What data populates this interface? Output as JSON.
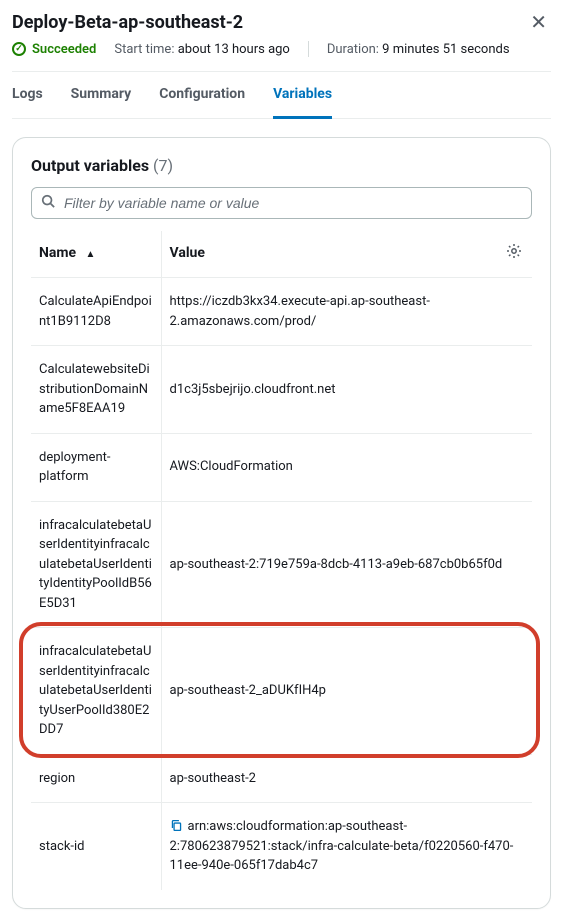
{
  "header": {
    "title": "Deploy-Beta-ap-southeast-2"
  },
  "status": {
    "text": "Succeeded",
    "start_label": "Start time:",
    "start_value": "about 13 hours ago",
    "duration_label": "Duration:",
    "duration_value": "9 minutes 51 seconds"
  },
  "tabs": {
    "logs": "Logs",
    "summary": "Summary",
    "configuration": "Configuration",
    "variables": "Variables"
  },
  "panel": {
    "title": "Output variables",
    "count": "(7)",
    "search_placeholder": "Filter by variable name or value"
  },
  "columns": {
    "name": "Name",
    "value": "Value"
  },
  "rows": [
    {
      "name": "CalculateApiEndpoint1B9112D8",
      "value": "https://iczdb3kx34.execute-api.ap-southeast-2.amazonaws.com/prod/"
    },
    {
      "name": "CalculatewebsiteDistributionDomainName5F8EAA19",
      "value": "d1c3j5sbejrijo.cloudfront.net"
    },
    {
      "name": "deployment-platform",
      "value": "AWS:CloudFormation"
    },
    {
      "name": "infracalculatebetaUserIdentityinfracalculatebetaUserIdentityIdentityPoolIdB56E5D31",
      "value": "ap-southeast-2:719e759a-8dcb-4113-a9eb-687cb0b65f0d"
    },
    {
      "name": "infracalculatebetaUserIdentityinfracalculatebetaUserIdentityUserPoolId380E2DD7",
      "value": "ap-southeast-2_aDUKfIH4p"
    },
    {
      "name": "region",
      "value": "ap-southeast-2"
    },
    {
      "name": "stack-id",
      "value": "arn:aws:cloudformation:ap-southeast-2:780623879521:stack/infra-calculate-beta/f0220560-f470-11ee-940e-065f17dab4c7"
    }
  ]
}
